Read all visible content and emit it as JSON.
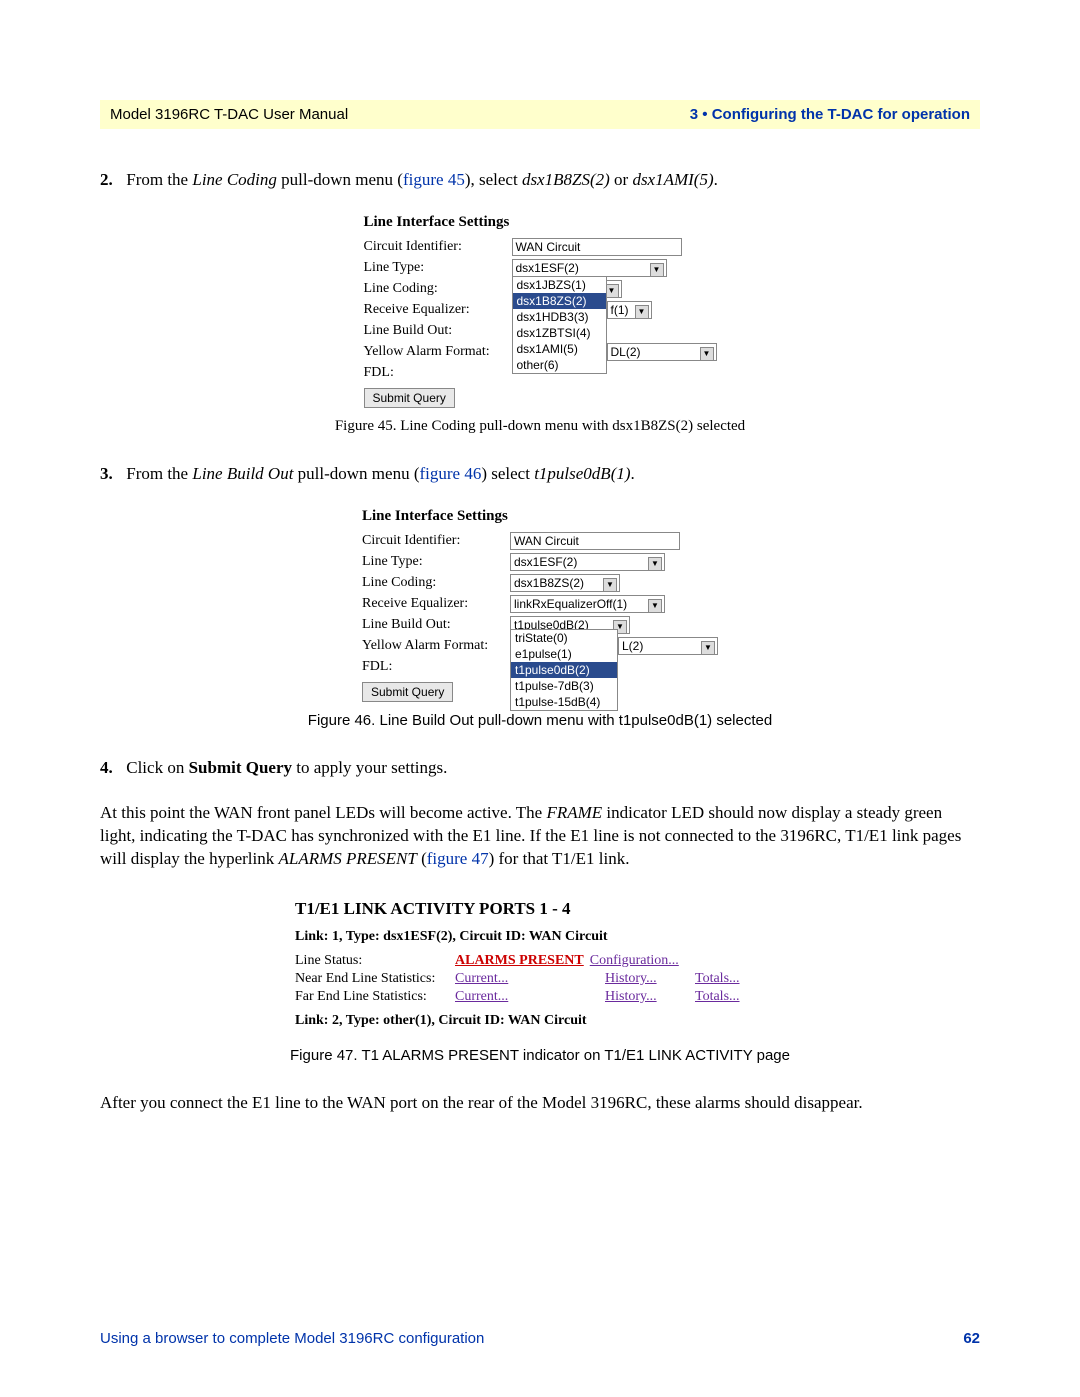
{
  "header": {
    "left": "Model 3196RC T-DAC User Manual",
    "right": "3 • Configuring the T-DAC for operation"
  },
  "steps": {
    "s2_prefix": "2.",
    "s2_a": "From the ",
    "s2_b": "Line Coding",
    "s2_c": " pull-down menu (",
    "s2_d": "figure 45",
    "s2_e": "), select ",
    "s2_f": "dsx1B8ZS(2)",
    "s2_g": " or ",
    "s2_h": "dsx1AMI(5)",
    "s2_i": ".",
    "s3_prefix": "3.",
    "s3_a": "From the ",
    "s3_b": "Line Build Out",
    "s3_c": " pull-down menu (",
    "s3_d": "figure 46",
    "s3_e": ") select ",
    "s3_f": "t1pulse0dB(1)",
    "s3_g": ".",
    "s4_prefix": "4.",
    "s4_a": "Click on ",
    "s4_b": "Submit Query",
    "s4_c": " to apply your settings."
  },
  "fig45": {
    "panel_title": "Line Interface Settings",
    "labels": {
      "circuit": "Circuit Identifier:",
      "line_type": "Line Type:",
      "line_coding": "Line Coding:",
      "rx_eq": "Receive Equalizer:",
      "lbo": "Line Build Out:",
      "yaf": "Yellow Alarm Format:",
      "fdl": "FDL:"
    },
    "values": {
      "circuit": "WAN Circuit",
      "line_type": "dsx1ESF(2)",
      "line_coding": "dsx1HDB3(3)",
      "rx_eq_tail": "f(1)",
      "yaf_tail": "DL(2)"
    },
    "dropdown": [
      "dsx1JBZS(1)",
      "dsx1B8ZS(2)",
      "dsx1HDB3(3)",
      "dsx1ZBTSI(4)",
      "dsx1AMI(5)",
      "other(6)"
    ],
    "selected_index": 1,
    "submit": "Submit Query",
    "caption": "Figure 45. Line Coding pull-down menu with dsx1B8ZS(2) selected"
  },
  "fig46": {
    "panel_title": "Line Interface Settings",
    "labels": {
      "circuit": "Circuit Identifier:",
      "line_type": "Line Type:",
      "line_coding": "Line Coding:",
      "rx_eq": "Receive Equalizer:",
      "lbo": "Line Build Out:",
      "yaf": "Yellow Alarm Format:",
      "fdl": "FDL:"
    },
    "values": {
      "circuit": "WAN Circuit",
      "line_type": "dsx1ESF(2)",
      "line_coding": "dsx1B8ZS(2)",
      "rx_eq": "linkRxEqualizerOff(1)",
      "lbo": "t1pulse0dB(2)",
      "yaf_tail": "L(2)"
    },
    "dropdown": [
      "triState(0)",
      "e1pulse(1)",
      "t1pulse0dB(2)",
      "t1pulse-7dB(3)",
      "t1pulse-15dB(4)"
    ],
    "selected_index": 2,
    "submit": "Submit Query",
    "caption": "Figure 46. Line Build Out pull-down menu with t1pulse0dB(1) selected"
  },
  "para1_a": "At this point the WAN front panel LEDs will become active. The ",
  "para1_b": "FRAME",
  "para1_c": " indicator LED should now display a steady green light, indicating the T-DAC has synchronized with the E1 line. If the E1 line is not connected to the 3196RC, T1/E1 link pages will display the hyperlink ",
  "para1_d": "ALARMS PRESENT",
  "para1_e": " (",
  "para1_f": "figure 47",
  "para1_g": ") for that T1/E1 link.",
  "fig47": {
    "title": "T1/E1 LINK ACTIVITY PORTS 1 - 4",
    "sub1": "Link: 1, Type: dsx1ESF(2), Circuit ID: WAN Circuit",
    "line_status_label": "Line Status:",
    "alarms": "ALARMS PRESENT",
    "config": "Configuration...",
    "near_label": "Near End Line Statistics:",
    "far_label": "Far End Line Statistics:",
    "current": "Current...",
    "history": "History...",
    "totals": "Totals...",
    "sub2": "Link: 2, Type: other(1), Circuit ID: WAN Circuit",
    "caption": "Figure 47. T1 ALARMS PRESENT indicator on T1/E1 LINK ACTIVITY page"
  },
  "para2": "After you connect the E1 line to the WAN port on the rear of the Model 3196RC, these alarms should disappear.",
  "footer": {
    "left": "Using a browser to complete Model 3196RC configuration",
    "right": "62"
  }
}
